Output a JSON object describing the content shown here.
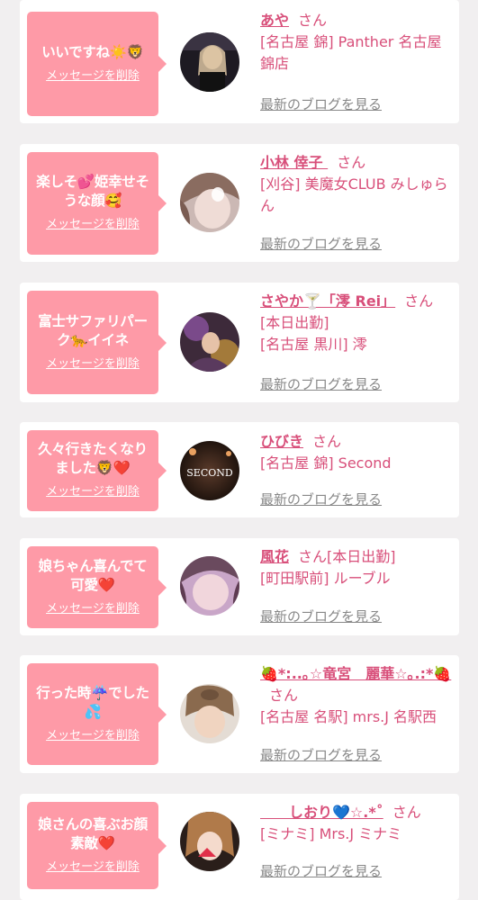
{
  "colors": {
    "page_background": "#f1eff0",
    "bubble": "#fe9aa7",
    "name_text": "#d84f7a",
    "link_gray": "#888888"
  },
  "delete_label": "メッセージを削除",
  "blog_label": "最新のブログを見る",
  "san_label": "さん",
  "cards": [
    {
      "message": "いいですね☀️🦁",
      "name": "あや",
      "details": [
        "[名古屋 錦] Panther 名古屋錦店"
      ],
      "avatar_icon": "avatar-photo-icon"
    },
    {
      "message": "楽しそ💕姫幸せそうな顔🥰",
      "name": "小林 倖子 ",
      "details": [
        "[刈谷] 美魔女CLUB みしゅらん"
      ],
      "avatar_icon": "avatar-photo-icon"
    },
    {
      "message": "富士サファリパーク🐆イイネ",
      "name": "さやか🍸「澪 Rei」",
      "details": [
        "[本日出勤]",
        "[名古屋 黒川] 澪"
      ],
      "avatar_icon": "avatar-photo-icon"
    },
    {
      "message": "久々行きたくなりました🦁❤️",
      "name": "ひびき",
      "details": [
        "[名古屋 錦] Second"
      ],
      "avatar_text": "SECOND",
      "avatar_icon": "avatar-photo-icon"
    },
    {
      "message": "娘ちゃん喜んでて可愛❤️",
      "name": "風花",
      "details_inline": "[本日出勤]",
      "details": [
        "[町田駅前] ルーブル"
      ],
      "avatar_icon": "avatar-photo-icon"
    },
    {
      "message": "行った時☔️でした💦",
      "name": "🍓*:..｡☆竜宮　麗華☆｡.:*🍓",
      "details": [
        "[名古屋 名駅] mrs.J 名駅西"
      ],
      "avatar_icon": "avatar-photo-icon"
    },
    {
      "message": "娘さんの喜ぶお顔素敵❤️",
      "name": "　　しおり💙☆.*˚",
      "details": [
        "[ミナミ] Mrs.J ミナミ"
      ],
      "avatar_icon": "avatar-photo-icon"
    }
  ]
}
